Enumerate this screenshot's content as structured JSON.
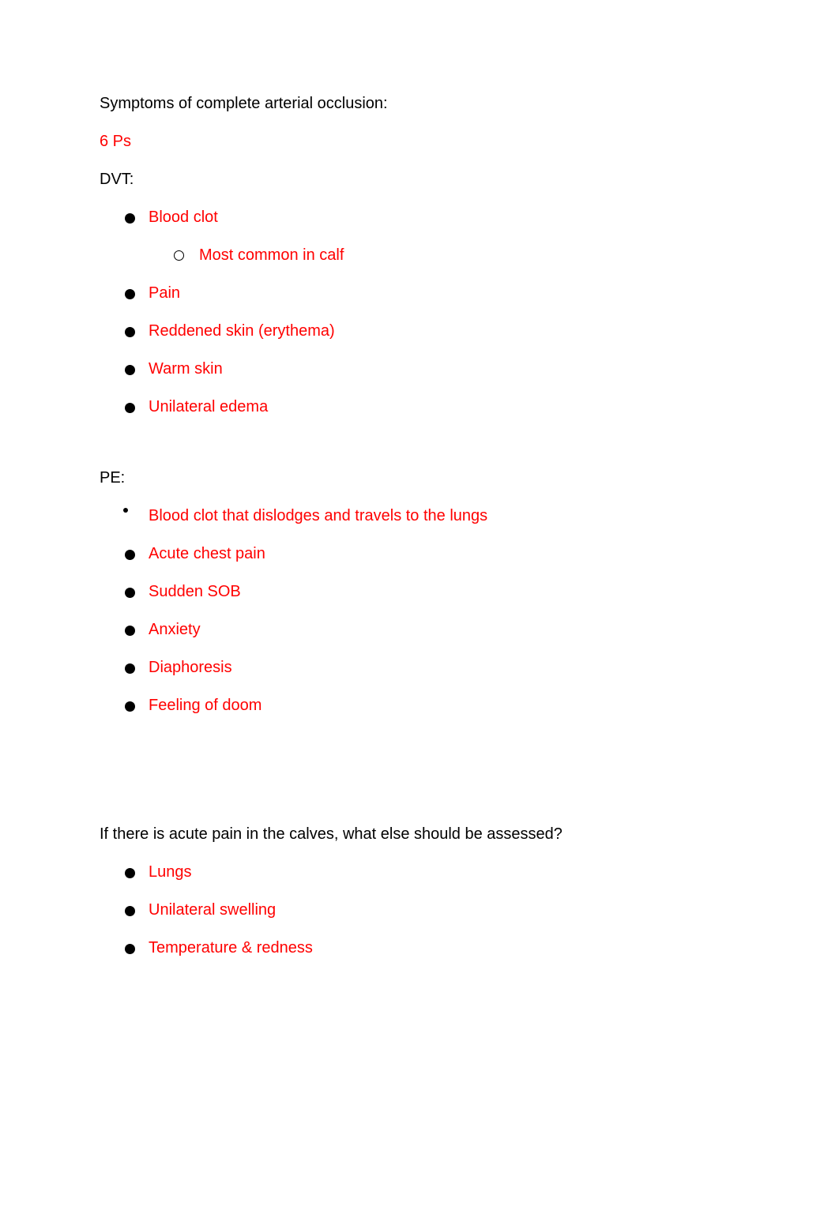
{
  "document": {
    "text_color": "#000000",
    "accent_color": "#ff0000",
    "background": "#ffffff",
    "blocks": {
      "heading_occlusion": "Symptoms of complete arterial occlusion:",
      "answer_six_ps": "6 Ps",
      "heading_dvt": "DVT:",
      "heading_pe": "PE:",
      "question_calves": "If there is acute pain in the calves, what else should be assessed?"
    },
    "dvt_list": {
      "items": [
        {
          "label": "Blood clot",
          "bullet": "filled-disc",
          "sub_items": [
            {
              "label": "Most common in calf",
              "bullet": "hollow-circle"
            }
          ]
        },
        {
          "label": "Pain",
          "bullet": "filled-disc"
        },
        {
          "label": "Reddened skin (erythema)",
          "bullet": "filled-disc"
        },
        {
          "label": "Warm skin",
          "bullet": "filled-disc"
        },
        {
          "label": "Unilateral edema",
          "bullet": "filled-disc"
        }
      ]
    },
    "pe_list": {
      "items": [
        {
          "label": "Blood clot that dislodges and travels to the lungs",
          "bullet": "small-dot"
        },
        {
          "label": "Acute chest pain",
          "bullet": "filled-disc"
        },
        {
          "label": "Sudden SOB",
          "bullet": "filled-disc"
        },
        {
          "label": "Anxiety",
          "bullet": "filled-disc"
        },
        {
          "label": "Diaphoresis",
          "bullet": "filled-disc"
        },
        {
          "label": "Feeling of doom",
          "bullet": "filled-disc"
        }
      ]
    },
    "calves_list": {
      "items": [
        {
          "label": "Lungs",
          "bullet": "filled-disc"
        },
        {
          "label": "Unilateral swelling",
          "bullet": "filled-disc"
        },
        {
          "label": "Temperature & redness",
          "bullet": "filled-disc"
        }
      ]
    }
  }
}
